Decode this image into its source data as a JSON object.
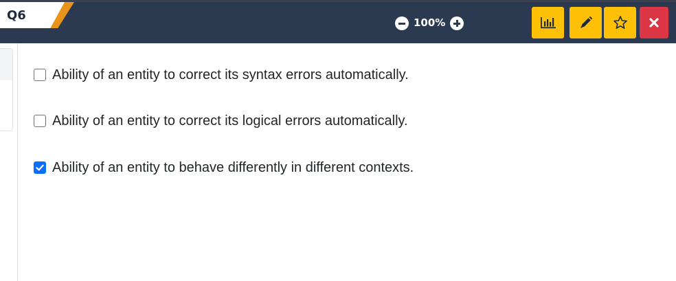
{
  "question": {
    "label": "Q6"
  },
  "zoom": {
    "value": "100%"
  },
  "toolbar": {
    "buttons": [
      {
        "name": "stats",
        "icon": "bar-chart-icon",
        "color": "#ffc107"
      },
      {
        "name": "edit",
        "icon": "pencil-icon",
        "color": "#ffc107"
      },
      {
        "name": "bookmark",
        "icon": "star-icon",
        "color": "#ffc107"
      },
      {
        "name": "close",
        "icon": "close-icon",
        "color": "#dc3545"
      }
    ]
  },
  "options": [
    {
      "text": "Ability of an entity to correct its syntax errors automatically.",
      "checked": false
    },
    {
      "text": "Ability of an entity to correct its logical errors automatically.",
      "checked": false
    },
    {
      "text": "Ability of an entity to behave differently in different contexts.",
      "checked": true
    }
  ],
  "colors": {
    "header_bg": "#2c3a51",
    "tab_accent": "#e8941a",
    "button_yellow": "#ffc107",
    "button_red": "#dc3545",
    "checkbox_checked": "#0d6efd"
  }
}
